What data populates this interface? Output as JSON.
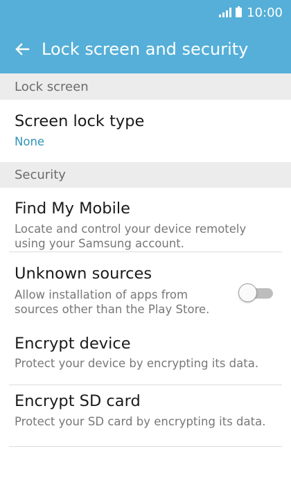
{
  "status_bar": {
    "time": "10:00",
    "signal": "signal-icon",
    "battery": "battery-icon"
  },
  "app_bar": {
    "back": "back-arrow-icon",
    "title": "Lock screen and security"
  },
  "sections": {
    "lock_screen": {
      "header": "Lock screen"
    },
    "security": {
      "header": "Security"
    }
  },
  "items": {
    "screen_lock_type": {
      "title": "Screen lock type",
      "value": "None"
    },
    "find_my_mobile": {
      "title": "Find My Mobile",
      "subtitle_line1": "Locate and control your device remotely",
      "subtitle_line2": "using your Samsung account."
    },
    "unknown_sources": {
      "title": "Unknown sources",
      "subtitle_line1": "Allow installation of apps from",
      "subtitle_line2": "sources other than the Play Store.",
      "toggle_on": false
    },
    "encrypt_device": {
      "title": "Encrypt device",
      "subtitle": "Protect your device by encrypting its data."
    },
    "encrypt_sd_card": {
      "title": "Encrypt SD card",
      "subtitle": "Protect your SD card by encrypting its data."
    }
  },
  "colors": {
    "accent": "#55afd8",
    "value_text": "#2f93b8",
    "section_bg": "#ececec"
  }
}
